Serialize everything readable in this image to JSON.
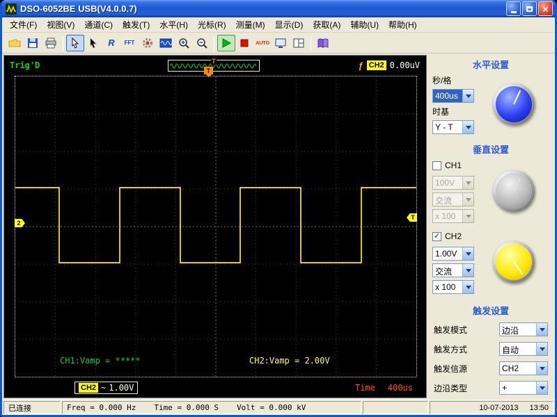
{
  "window": {
    "title": "DSO-6052BE USB(V4.0.0.7)"
  },
  "menu": {
    "items": [
      "文件(F)",
      "视图(V)",
      "通道(C)",
      "触发(T)",
      "水平(H)",
      "光标(R)",
      "测量(M)",
      "显示(D)",
      "获取(A)",
      "辅助(U)",
      "帮助(H)"
    ]
  },
  "toolbar": {
    "r_label": "R",
    "fft_label": "FFT",
    "auto_label": "AUTO"
  },
  "trig_bar": {
    "status": "Trig'D",
    "preview_marker": "T",
    "trigger_symbol": "ƒ",
    "channel_badge": "CH2",
    "level_value": "0.00uV"
  },
  "scope": {
    "top_marker": "T",
    "left_marker": "2",
    "right_marker": "T",
    "ch1_measure": "CH1:Vamp = *****",
    "ch2_measure": "CH2:Vamp = 2.00V",
    "waveform": {
      "type": "square",
      "channel": "CH2",
      "color": "#ffee00",
      "volts_div": "1.00V",
      "time_div": "400us",
      "vamp": "2.00V"
    },
    "footer": {
      "channel_badge": "CH2",
      "coupling_symbol": "~",
      "volts_div": "1.00V",
      "time_label": "Time",
      "time_value": "400us"
    }
  },
  "panel": {
    "horizontal": {
      "title": "水平设置",
      "secdiv_label": "秒/格",
      "secdiv_value": "400us",
      "timebase_label": "时基",
      "timebase_value": "Y - T"
    },
    "vertical": {
      "title": "垂直设置",
      "ch1_label": "CH1",
      "ch1_checked": false,
      "ch1_volts": "100V",
      "ch1_coupling": "交流",
      "ch1_probe": "x 100",
      "ch2_label": "CH2",
      "ch2_checked": true,
      "ch2_check_glyph": "✓",
      "ch2_volts": "1.00V",
      "ch2_coupling": "交流",
      "ch2_probe": "x 100"
    },
    "trigger": {
      "title": "触发设置",
      "rows": [
        {
          "label": "触发模式",
          "value": "边沿"
        },
        {
          "label": "触发方式",
          "value": "自动"
        },
        {
          "label": "触发信源",
          "value": "CH2"
        },
        {
          "label": "边沿类型",
          "value": "+"
        }
      ]
    }
  },
  "statusbar": {
    "connection": "已连接",
    "freq": "Freq = 0.000 Hz",
    "time": "Time = 0.000 S",
    "volt": "Volt = 0.000 kV",
    "date": "10-07-2013",
    "clock": "13:50"
  }
}
